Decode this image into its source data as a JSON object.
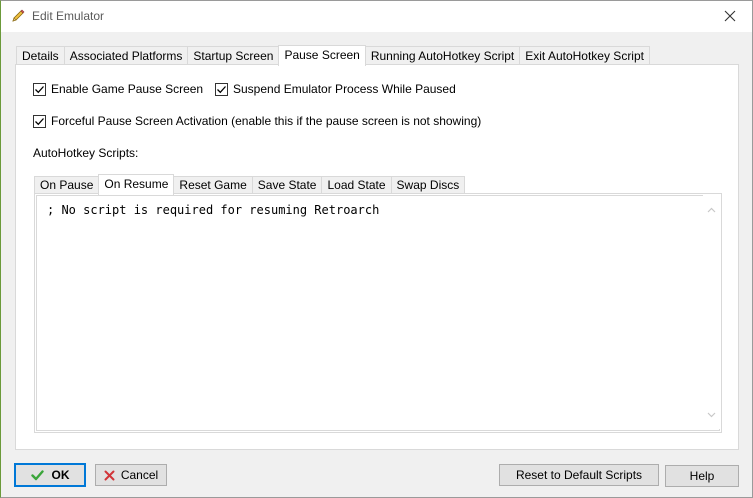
{
  "window": {
    "title": "Edit Emulator"
  },
  "tabs": [
    {
      "label": "Details",
      "active": false
    },
    {
      "label": "Associated Platforms",
      "active": false
    },
    {
      "label": "Startup Screen",
      "active": false
    },
    {
      "label": "Pause Screen",
      "active": true
    },
    {
      "label": "Running AutoHotkey Script",
      "active": false
    },
    {
      "label": "Exit AutoHotkey Script",
      "active": false
    }
  ],
  "options": {
    "enable_pause": {
      "label": "Enable Game Pause Screen",
      "checked": true
    },
    "suspend_process": {
      "label": "Suspend Emulator Process While Paused",
      "checked": true
    },
    "forceful_activation": {
      "label": "Forceful Pause Screen Activation (enable this if the pause screen is not showing)",
      "checked": true
    }
  },
  "scripts_label": "AutoHotkey Scripts:",
  "script_tabs": [
    {
      "label": "On Pause",
      "active": false
    },
    {
      "label": "On Resume",
      "active": true
    },
    {
      "label": "Reset Game",
      "active": false
    },
    {
      "label": "Save State",
      "active": false
    },
    {
      "label": "Load State",
      "active": false
    },
    {
      "label": "Swap Discs",
      "active": false
    }
  ],
  "script_text": "; No script is required for resuming Retroarch",
  "buttons": {
    "ok": "OK",
    "cancel": "Cancel",
    "reset": "Reset to Default Scripts",
    "help": "Help"
  },
  "colors": {
    "accent": "#0078d7",
    "ok_check": "#3aa53a",
    "cancel_x": "#d13438"
  }
}
